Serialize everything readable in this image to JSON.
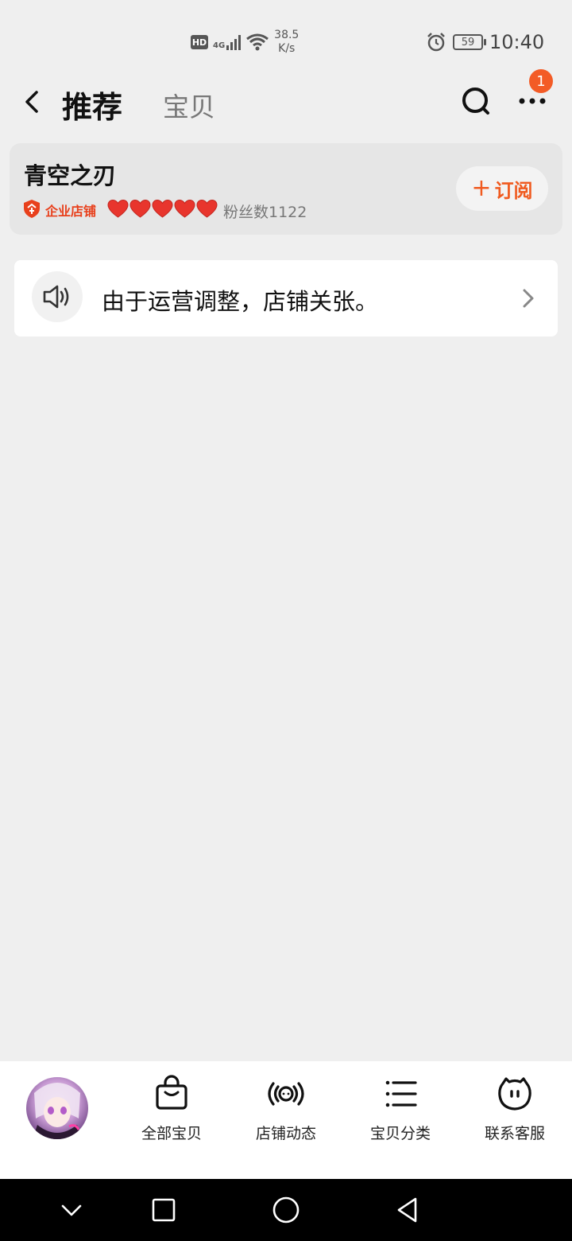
{
  "status_bar": {
    "hd": "HD",
    "network": "4G",
    "speed_value": "38.5",
    "speed_unit": "K/s",
    "battery": "59",
    "time": "10:40",
    "icons": [
      "hd-icon",
      "signal-icon",
      "wifi-icon",
      "alarm-icon",
      "battery-icon"
    ]
  },
  "header": {
    "active_tab": "推荐",
    "second_tab": "宝贝",
    "notification_count": "1",
    "icons": [
      "back-icon",
      "search-icon",
      "more-icon"
    ]
  },
  "shop": {
    "name": "青空之刃",
    "badge_label": "企业店铺",
    "hearts_count": 5,
    "fans": "粉丝数1122",
    "subscribe_plus": "+",
    "subscribe_label": "订阅"
  },
  "notice": {
    "text": "由于运营调整，店铺关张。",
    "icons": [
      "speaker-icon",
      "chevron-right-icon"
    ]
  },
  "bottom_tabs": [
    {
      "label": "全部宝贝",
      "icon": "shopping-bag-icon"
    },
    {
      "label": "店铺动态",
      "icon": "broadcast-icon"
    },
    {
      "label": "宝贝分类",
      "icon": "list-icon"
    },
    {
      "label": "联系客服",
      "icon": "chat-face-icon"
    }
  ],
  "system_nav": {
    "icons": [
      "collapse-icon",
      "recent-apps-icon",
      "home-icon",
      "back-triangle-icon"
    ]
  },
  "colors": {
    "accent": "#f05a1f",
    "badge": "#f35b26",
    "background": "#efefef",
    "heart": "#e8352d"
  }
}
